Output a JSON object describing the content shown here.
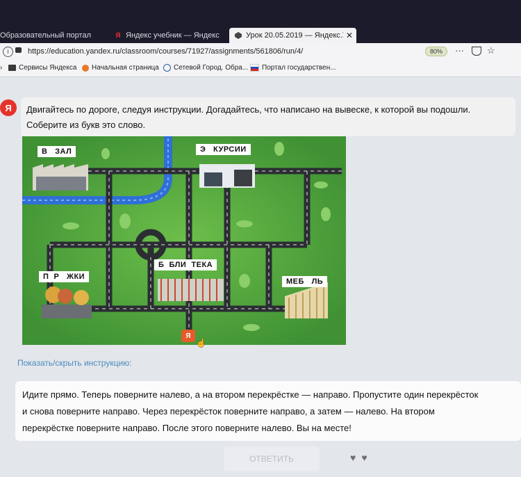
{
  "browser": {
    "tabs": [
      {
        "label": "Образовательный портал",
        "active": false
      },
      {
        "label": "Яндекс учебник — Яндекс",
        "active": false
      },
      {
        "label": "Урок 20.05.2019 — Яндекс.Уче",
        "active": true
      }
    ],
    "url": "https://education.yandex.ru/classroom/courses/71927/assignments/561806/run/4/",
    "zoom": "80%",
    "bookmarks": [
      "Сервисы Яндекса",
      "Начальная страница",
      "Сетевой Город. Обра...",
      "Портал государствен..."
    ]
  },
  "task": {
    "avatar_letter": "Я",
    "prompt_line1": "Двигайтесь по дороге, следуя инструкции. Догадайтесь, что написано на вывеске, к которой вы подошли.",
    "prompt_line2": "Соберите из букв это слово."
  },
  "map": {
    "signs": {
      "top_left": "В   ЗАЛ",
      "top_center": "Э   КУРСИИ",
      "mid_left": "П  Р   ЖКИ",
      "mid_center": "Б  БЛИ  ТЕКА",
      "mid_right": "МЕБ   ЛЬ"
    },
    "marker_letter": "Я"
  },
  "instructions_toggle": "Показать/скрыть инструкцию:",
  "instructions": {
    "line1": "Идите прямо. Теперь поверните налево, а на втором перекрёстке — направо. Пропустите один перекрёсток",
    "line2": "и снова поверните направо. Через перекрёсток поверните направо, а затем — налево. На втором",
    "line3": "перекрёстке поверните направо. После этого поверните налево. Вы на месте!"
  },
  "answer_button": "ОТВЕТИТЬ",
  "colors": {
    "grass": "#4fa33e",
    "road": "#2b2d33",
    "water": "#2f6fd6",
    "brand_red": "#e6322c",
    "link": "#4a8bbf"
  }
}
